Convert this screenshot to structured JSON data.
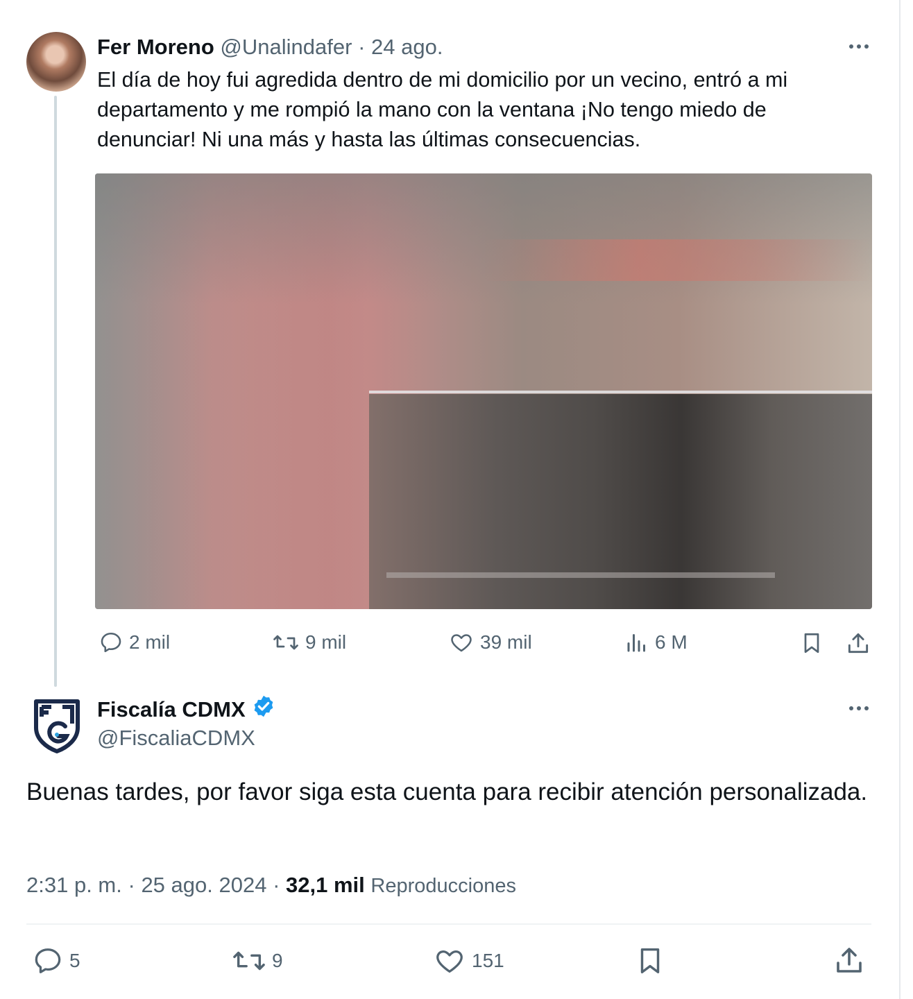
{
  "tweet1": {
    "display_name": "Fer Moreno",
    "handle": "@Unalindafer",
    "separator": "·",
    "date": "24 ago.",
    "text": "El día de hoy fui agredida dentro de mi domicilio por un vecino, entró a mi departamento y me rompió la mano con la ventana ¡No tengo miedo de denunciar! Ni una más y hasta las últimas consecuencias.",
    "replies": "2 mil",
    "retweets": "9 mil",
    "likes": "39 mil",
    "views": "6 M"
  },
  "tweet2": {
    "display_name": "Fiscalía CDMX",
    "handle": "@FiscaliaCDMX",
    "text": "Buenas tardes, por favor siga esta cuenta para recibir atención personalizada.",
    "time": "2:31 p. m.",
    "date": "25 ago. 2024",
    "separator": "·",
    "views_count": "32,1 mil",
    "views_label": "Reproducciones",
    "replies": "5",
    "retweets": "9",
    "likes": "151"
  },
  "colors": {
    "text": "#0f1419",
    "muted": "#536471",
    "verified": "#1d9bf0",
    "fiscalia_navy": "#1b2a4a",
    "thread_line": "#cfd9de"
  },
  "icons": [
    "more-icon",
    "reply-icon",
    "retweet-icon",
    "like-icon",
    "views-icon",
    "bookmark-icon",
    "share-icon",
    "verified-icon"
  ]
}
